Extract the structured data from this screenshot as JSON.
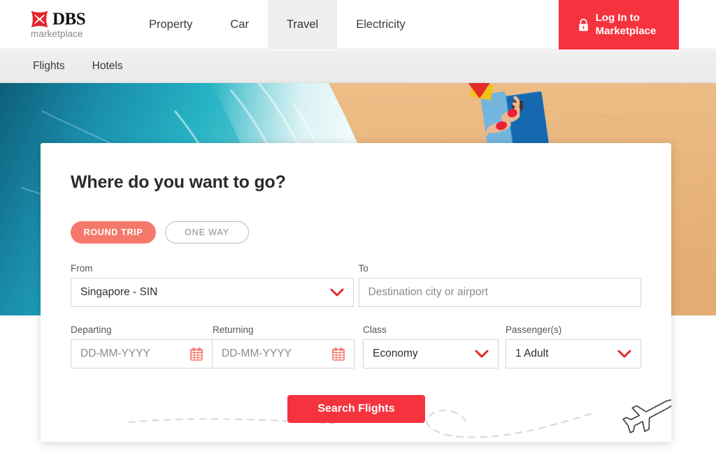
{
  "header": {
    "logo": {
      "mark": "dbs-x-logo-icon",
      "name": "DBS",
      "tagline": "marketplace"
    },
    "nav": [
      {
        "label": "Property",
        "active": false
      },
      {
        "label": "Car",
        "active": false
      },
      {
        "label": "Travel",
        "active": true
      },
      {
        "label": "Electricity",
        "active": false
      }
    ],
    "login": {
      "icon": "lock-icon",
      "line1": "Log In to",
      "line2": "Marketplace"
    }
  },
  "subnav": {
    "items": [
      {
        "label": "Flights"
      },
      {
        "label": "Hotels"
      }
    ]
  },
  "hero": {
    "alt": "aerial-beach-ocean-sunbather"
  },
  "search": {
    "title": "Where do you want to go?",
    "trip_types": [
      {
        "label": "ROUND TRIP",
        "selected": true
      },
      {
        "label": "ONE WAY",
        "selected": false
      }
    ],
    "from": {
      "label": "From",
      "value": "Singapore - SIN",
      "icon": "chevron-down-icon"
    },
    "to": {
      "label": "To",
      "value": "",
      "placeholder": "Destination city or airport"
    },
    "departing": {
      "label": "Departing",
      "value": "",
      "placeholder": "DD-MM-YYYY",
      "icon": "calendar-icon"
    },
    "returning": {
      "label": "Returning",
      "value": "",
      "placeholder": "DD-MM-YYYY",
      "icon": "calendar-icon"
    },
    "travel_class": {
      "label": "Class",
      "value": "Economy",
      "icon": "chevron-down-icon"
    },
    "passengers": {
      "label": "Passenger(s)",
      "value": "1 Adult",
      "icon": "chevron-down-icon"
    },
    "submit": {
      "label": "Search Flights"
    },
    "decoration": {
      "icon": "airplane-icon",
      "path": "dashed-flight-path"
    }
  },
  "colors": {
    "brand_red": "#f5333f",
    "accent_salmon": "#f4796b",
    "active_tab_bg": "#eeeeee",
    "subnav_bg": "#ededed",
    "text_dark": "#2b2b2b",
    "text_muted": "#8b8b8b",
    "border": "#d4d4d4"
  }
}
